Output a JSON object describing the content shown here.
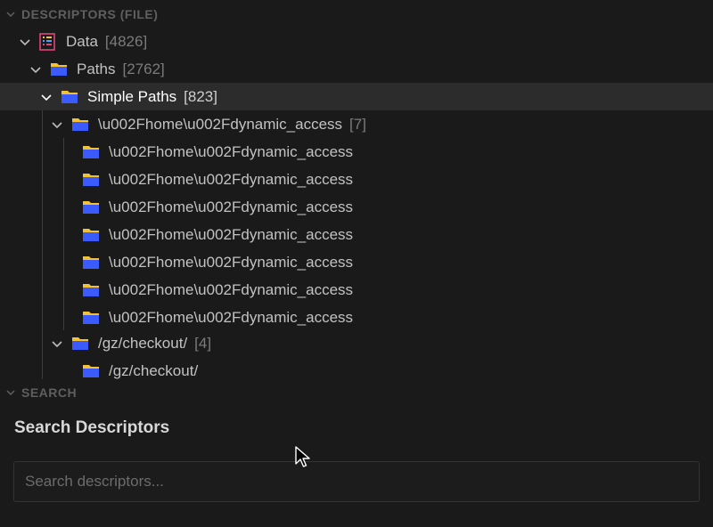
{
  "sections": {
    "descriptors_header": "DESCRIPTORS (FILE)",
    "search_header": "SEARCH"
  },
  "tree": {
    "data": {
      "label": "Data",
      "count": "[4826]",
      "icon": "data-icon"
    },
    "paths": {
      "label": "Paths",
      "count": "[2762]",
      "icon": "folder-icon"
    },
    "simple_paths": {
      "label": "Simple Paths",
      "count": "[823]",
      "icon": "folder-icon"
    },
    "group1": {
      "label": "\\u002Fhome\\u002Fdynamic_access",
      "count": "[7]",
      "icon": "folder-icon"
    },
    "group1_items": [
      "\\u002Fhome\\u002Fdynamic_access",
      "\\u002Fhome\\u002Fdynamic_access",
      "\\u002Fhome\\u002Fdynamic_access",
      "\\u002Fhome\\u002Fdynamic_access",
      "\\u002Fhome\\u002Fdynamic_access",
      "\\u002Fhome\\u002Fdynamic_access",
      "\\u002Fhome\\u002Fdynamic_access"
    ],
    "group2": {
      "label": "/gz/checkout/",
      "count": "[4]",
      "icon": "folder-icon"
    },
    "group2_items": [
      "/gz/checkout/"
    ]
  },
  "search": {
    "title": "Search Descriptors",
    "placeholder": "Search descriptors..."
  },
  "colors": {
    "background": "#1a1a1a",
    "selected_row": "#2c2c2c",
    "folder_blue": "#3b5bff",
    "folder_yellow": "#f2c233"
  }
}
